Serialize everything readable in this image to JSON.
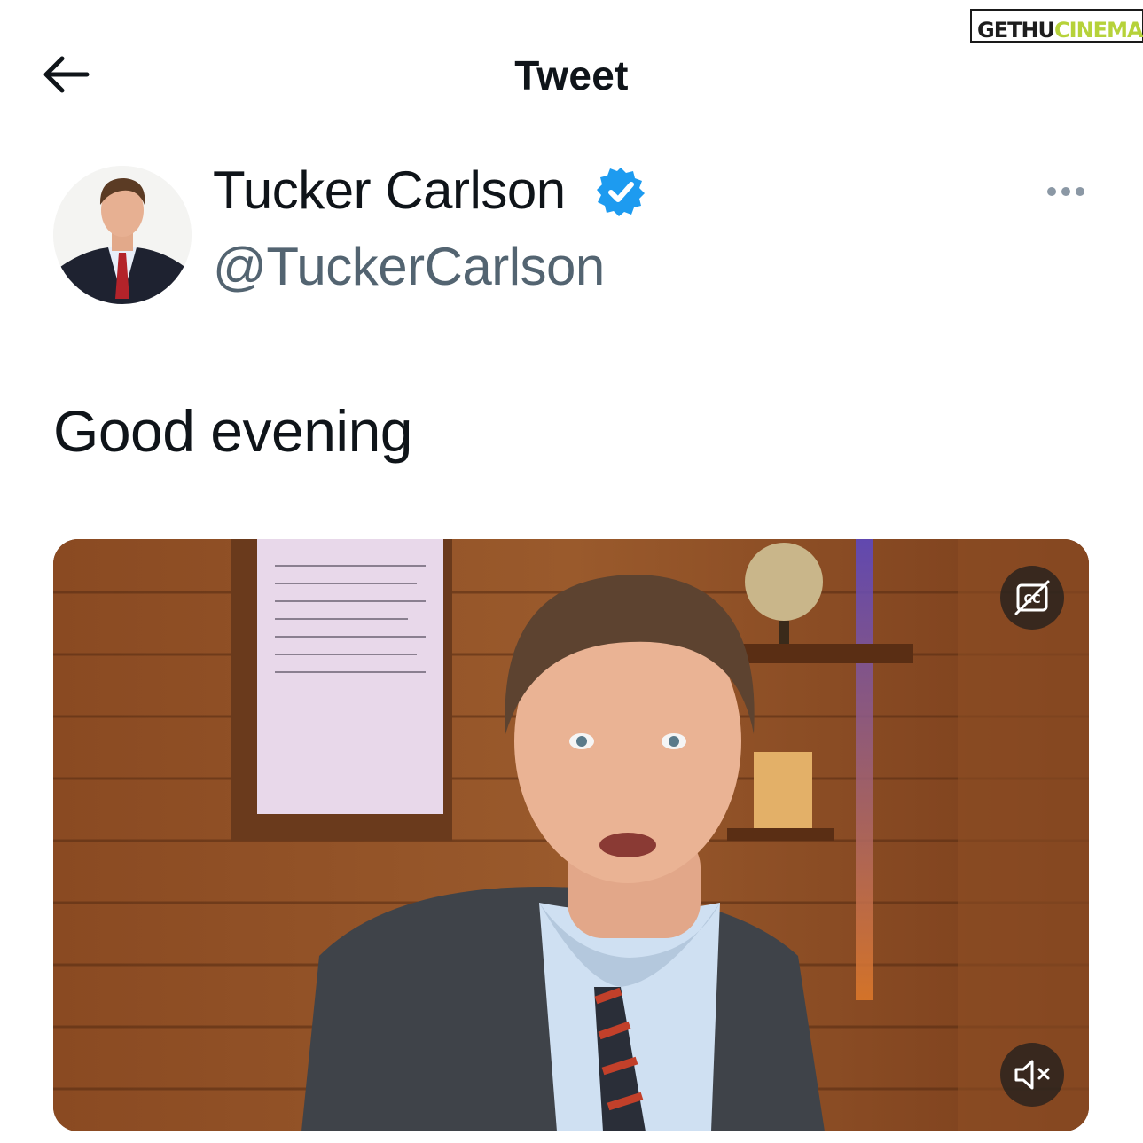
{
  "watermark": {
    "part1": "GETHU",
    "part2": "CINEMA"
  },
  "header": {
    "title": "Tweet",
    "back_icon": "arrow-left-icon"
  },
  "tweet": {
    "author": {
      "display_name": "Tucker Carlson",
      "handle": "@TuckerCarlson",
      "verified": true
    },
    "text": "Good evening",
    "media": {
      "type": "video",
      "controls": {
        "captions_icon": "closed-captions-off-icon",
        "mute_icon": "speaker-muted-icon"
      }
    }
  },
  "colors": {
    "verified_blue": "#1d9bf0",
    "handle_gray": "#536471",
    "text": "#0f1419"
  }
}
